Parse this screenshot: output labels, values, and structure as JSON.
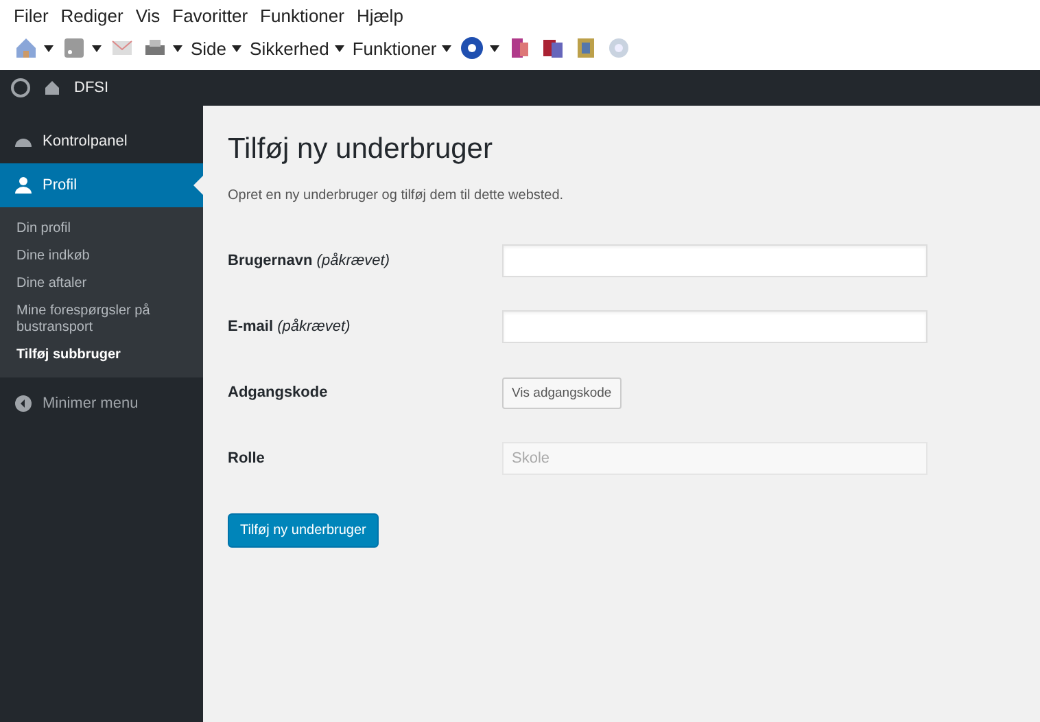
{
  "menu_bar": [
    "Filer",
    "Rediger",
    "Vis",
    "Favoritter",
    "Funktioner",
    "Hjælp"
  ],
  "toolbar": [
    {
      "kind": "text",
      "label": "Side"
    },
    {
      "kind": "text",
      "label": "Sikkerhed"
    },
    {
      "kind": "text",
      "label": "Funktioner"
    }
  ],
  "admin_bar": {
    "site": "DFSI"
  },
  "sidebar": {
    "items": [
      {
        "label": "Kontrolpanel",
        "selected": false
      },
      {
        "label": "Profil",
        "selected": true,
        "children": [
          {
            "label": "Din profil",
            "selected": false
          },
          {
            "label": "Dine indkøb",
            "selected": false
          },
          {
            "label": "Dine aftaler",
            "selected": false
          },
          {
            "label": "Mine forespørgsler på bustransport",
            "selected": false
          },
          {
            "label": "Tilføj subbruger",
            "selected": true
          }
        ]
      }
    ],
    "collapse": "Minimer menu"
  },
  "page": {
    "title": "Tilføj ny underbruger",
    "description": "Opret en ny underbruger og tilføj dem til dette websted.",
    "fields": [
      {
        "kind": "input",
        "label": "Brugernavn *(påkrævet)*"
      },
      {
        "kind": "input",
        "label": "E-mail *(påkrævet)*"
      },
      {
        "kind": "button",
        "label": "Adgangskode",
        "button": "Vis adgangskode"
      },
      {
        "kind": "select",
        "label": "Rolle",
        "value": "Skole",
        "disabled": true
      }
    ],
    "submit": "Tilføj ny underbruger"
  }
}
